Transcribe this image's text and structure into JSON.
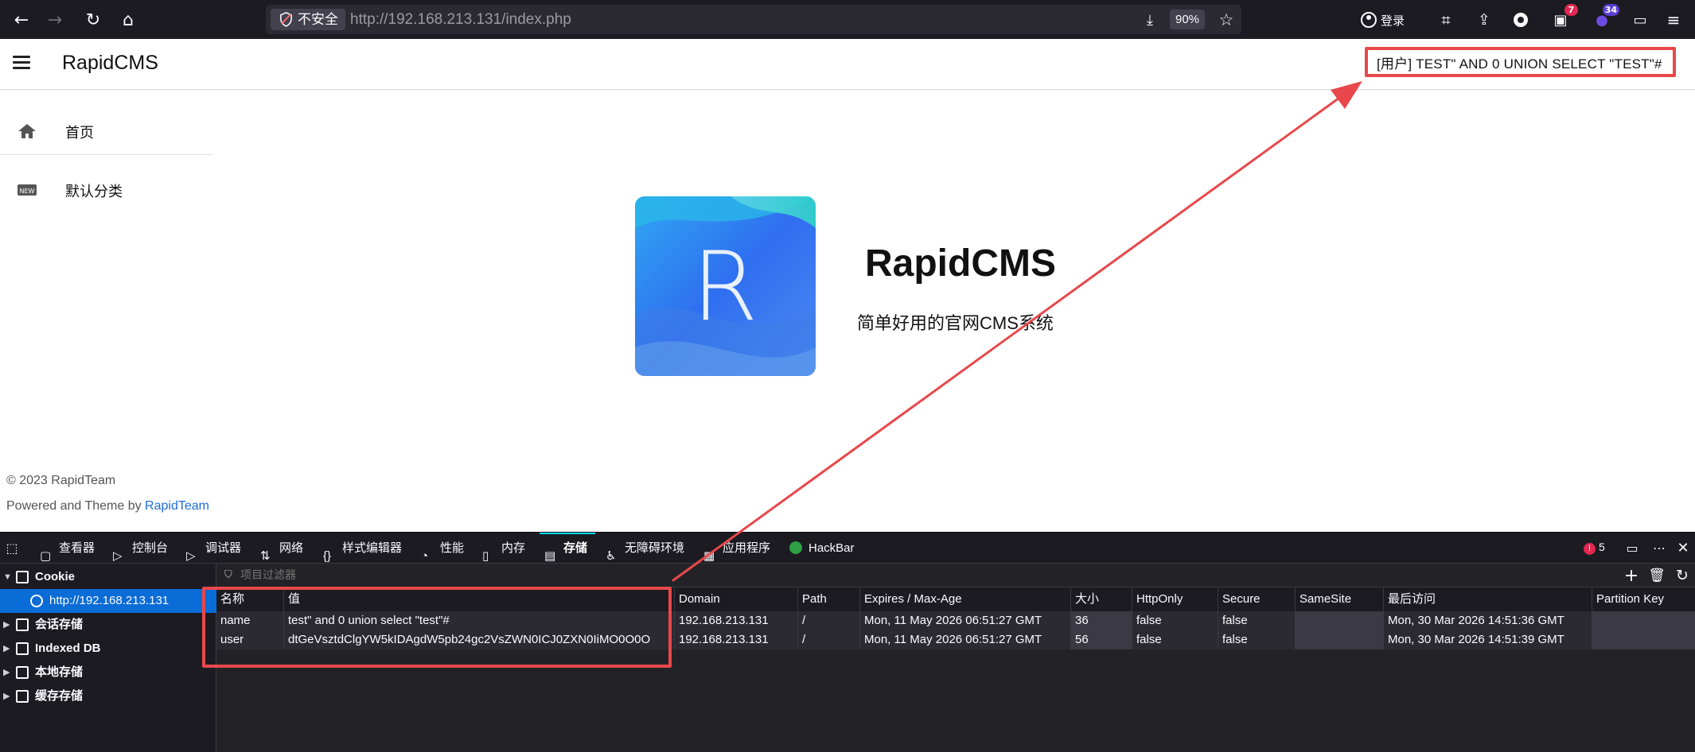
{
  "browser": {
    "insecure_label": "不安全",
    "url_host": "http://192.168.213.131",
    "url_path": "/index.php",
    "zoom": "90%",
    "login_label": "登录",
    "ext_badge_1": "7",
    "ext_badge_2": "34"
  },
  "page": {
    "site_title": "RapidCMS",
    "user_label": "[用户] TEST\" AND 0 UNION SELECT \"TEST\"#",
    "nav": [
      {
        "label": "首页",
        "icon": "home-icon"
      },
      {
        "label": "默认分类",
        "icon": "new-badge-icon"
      }
    ],
    "logo_letter": "R",
    "brand_title": "RapidCMS",
    "brand_subtitle": "简单好用的官网CMS系统",
    "copyright": "© 2023 RapidTeam",
    "powered_prefix": "Powered and Theme by ",
    "powered_link": "RapidTeam"
  },
  "devtools": {
    "tabs": [
      {
        "label": "查看器",
        "icon": "inspector-icon"
      },
      {
        "label": "控制台",
        "icon": "console-icon"
      },
      {
        "label": "调试器",
        "icon": "debugger-icon"
      },
      {
        "label": "网络",
        "icon": "network-icon"
      },
      {
        "label": "样式编辑器",
        "icon": "style-editor-icon"
      },
      {
        "label": "性能",
        "icon": "performance-icon"
      },
      {
        "label": "内存",
        "icon": "memory-icon"
      },
      {
        "label": "存储",
        "icon": "storage-icon"
      },
      {
        "label": "无障碍环境",
        "icon": "accessibility-icon"
      },
      {
        "label": "应用程序",
        "icon": "application-icon"
      },
      {
        "label": "HackBar",
        "icon": "hackbar-icon"
      }
    ],
    "error_count": "5",
    "sidebar": [
      {
        "label": "Cookie",
        "expanded": true
      },
      {
        "label": "http://192.168.213.131",
        "child": true
      },
      {
        "label": "会话存储"
      },
      {
        "label": "Indexed DB"
      },
      {
        "label": "本地存储"
      },
      {
        "label": "缓存存储"
      }
    ],
    "filter_placeholder": "项目过滤器",
    "columns": [
      "名称",
      "值",
      "Domain",
      "Path",
      "Expires / Max-Age",
      "大小",
      "HttpOnly",
      "Secure",
      "SameSite",
      "最后访问",
      "Partition Key"
    ],
    "rows": [
      [
        "name",
        "test\" and 0 union select \"test\"#",
        "192.168.213.131",
        "/",
        "Mon, 11 May 2026 06:51:27 GMT",
        "36",
        "false",
        "false",
        "",
        "Mon, 30 Mar 2026 14:51:36 GMT",
        ""
      ],
      [
        "user",
        "dtGeVsztdClgYW5kIDAgdW5pb24gc2VsZWN0ICJ0ZXN0IiMO0O0O",
        "192.168.213.131",
        "/",
        "Mon, 11 May 2026 06:51:27 GMT",
        "56",
        "false",
        "false",
        "",
        "Mon, 30 Mar 2026 14:51:39 GMT",
        ""
      ]
    ]
  },
  "colors": {
    "annotation": "#e8484b",
    "toolbar": "#1c1b22",
    "link": "#1e6bd6"
  }
}
